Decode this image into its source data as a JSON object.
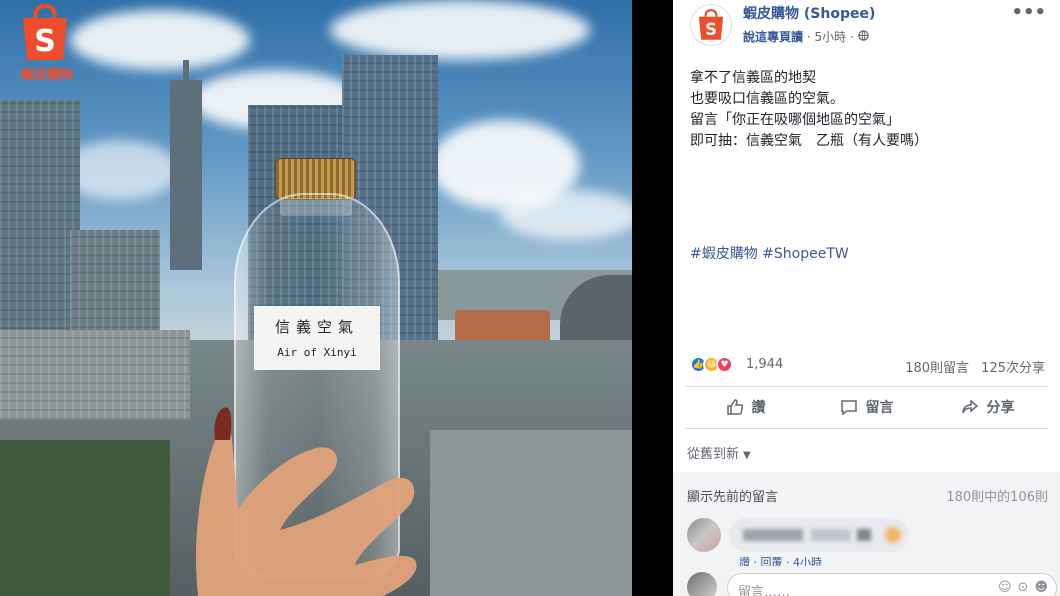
{
  "photo": {
    "logo_caption": "蝦皮購物",
    "bottle_label_title": "信義空氣",
    "bottle_label_sub": "Air of Xinyi"
  },
  "post": {
    "author": "蝦皮購物 (Shopee)",
    "translate": "說這專頁讀",
    "time": "5小時",
    "more": "•••",
    "body_lines": [
      "拿不了信義區的地契",
      "也要吸口信義區的空氣。",
      "",
      "",
      "留言「你正在吸哪個地區的空氣」",
      "即可抽：信義空氣　乙瓶（有人要嗎）"
    ],
    "hashtags": "#蝦皮購物 #ShopeeTW",
    "reactions_count": "1,944",
    "comments_count": "180則留言",
    "shares_count": "125次分享",
    "action_like": "讚",
    "action_comment": "留言",
    "action_share": "分享",
    "sort_label": "從舊到新",
    "prev_comments": "顯示先前的留言",
    "prev_count": "180則中的106則",
    "comment_meta": "讚 · 回覆 · 4小時",
    "write_placeholder": "留言……"
  },
  "colors": {
    "brand": "#ee4d2d",
    "link": "#385898"
  }
}
